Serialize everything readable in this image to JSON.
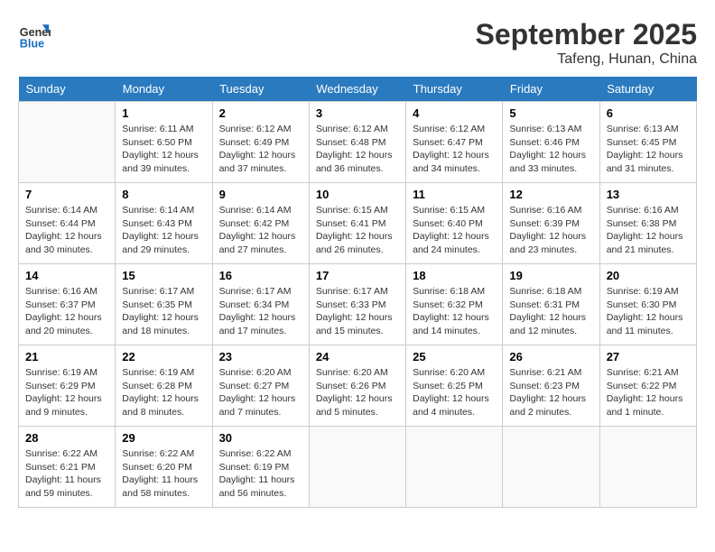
{
  "header": {
    "logo_line1": "General",
    "logo_line2": "Blue",
    "month_year": "September 2025",
    "location": "Tafeng, Hunan, China"
  },
  "days_of_week": [
    "Sunday",
    "Monday",
    "Tuesday",
    "Wednesday",
    "Thursday",
    "Friday",
    "Saturday"
  ],
  "weeks": [
    [
      {
        "day": "",
        "info": ""
      },
      {
        "day": "1",
        "info": "Sunrise: 6:11 AM\nSunset: 6:50 PM\nDaylight: 12 hours\nand 39 minutes."
      },
      {
        "day": "2",
        "info": "Sunrise: 6:12 AM\nSunset: 6:49 PM\nDaylight: 12 hours\nand 37 minutes."
      },
      {
        "day": "3",
        "info": "Sunrise: 6:12 AM\nSunset: 6:48 PM\nDaylight: 12 hours\nand 36 minutes."
      },
      {
        "day": "4",
        "info": "Sunrise: 6:12 AM\nSunset: 6:47 PM\nDaylight: 12 hours\nand 34 minutes."
      },
      {
        "day": "5",
        "info": "Sunrise: 6:13 AM\nSunset: 6:46 PM\nDaylight: 12 hours\nand 33 minutes."
      },
      {
        "day": "6",
        "info": "Sunrise: 6:13 AM\nSunset: 6:45 PM\nDaylight: 12 hours\nand 31 minutes."
      }
    ],
    [
      {
        "day": "7",
        "info": "Sunrise: 6:14 AM\nSunset: 6:44 PM\nDaylight: 12 hours\nand 30 minutes."
      },
      {
        "day": "8",
        "info": "Sunrise: 6:14 AM\nSunset: 6:43 PM\nDaylight: 12 hours\nand 29 minutes."
      },
      {
        "day": "9",
        "info": "Sunrise: 6:14 AM\nSunset: 6:42 PM\nDaylight: 12 hours\nand 27 minutes."
      },
      {
        "day": "10",
        "info": "Sunrise: 6:15 AM\nSunset: 6:41 PM\nDaylight: 12 hours\nand 26 minutes."
      },
      {
        "day": "11",
        "info": "Sunrise: 6:15 AM\nSunset: 6:40 PM\nDaylight: 12 hours\nand 24 minutes."
      },
      {
        "day": "12",
        "info": "Sunrise: 6:16 AM\nSunset: 6:39 PM\nDaylight: 12 hours\nand 23 minutes."
      },
      {
        "day": "13",
        "info": "Sunrise: 6:16 AM\nSunset: 6:38 PM\nDaylight: 12 hours\nand 21 minutes."
      }
    ],
    [
      {
        "day": "14",
        "info": "Sunrise: 6:16 AM\nSunset: 6:37 PM\nDaylight: 12 hours\nand 20 minutes."
      },
      {
        "day": "15",
        "info": "Sunrise: 6:17 AM\nSunset: 6:35 PM\nDaylight: 12 hours\nand 18 minutes."
      },
      {
        "day": "16",
        "info": "Sunrise: 6:17 AM\nSunset: 6:34 PM\nDaylight: 12 hours\nand 17 minutes."
      },
      {
        "day": "17",
        "info": "Sunrise: 6:17 AM\nSunset: 6:33 PM\nDaylight: 12 hours\nand 15 minutes."
      },
      {
        "day": "18",
        "info": "Sunrise: 6:18 AM\nSunset: 6:32 PM\nDaylight: 12 hours\nand 14 minutes."
      },
      {
        "day": "19",
        "info": "Sunrise: 6:18 AM\nSunset: 6:31 PM\nDaylight: 12 hours\nand 12 minutes."
      },
      {
        "day": "20",
        "info": "Sunrise: 6:19 AM\nSunset: 6:30 PM\nDaylight: 12 hours\nand 11 minutes."
      }
    ],
    [
      {
        "day": "21",
        "info": "Sunrise: 6:19 AM\nSunset: 6:29 PM\nDaylight: 12 hours\nand 9 minutes."
      },
      {
        "day": "22",
        "info": "Sunrise: 6:19 AM\nSunset: 6:28 PM\nDaylight: 12 hours\nand 8 minutes."
      },
      {
        "day": "23",
        "info": "Sunrise: 6:20 AM\nSunset: 6:27 PM\nDaylight: 12 hours\nand 7 minutes."
      },
      {
        "day": "24",
        "info": "Sunrise: 6:20 AM\nSunset: 6:26 PM\nDaylight: 12 hours\nand 5 minutes."
      },
      {
        "day": "25",
        "info": "Sunrise: 6:20 AM\nSunset: 6:25 PM\nDaylight: 12 hours\nand 4 minutes."
      },
      {
        "day": "26",
        "info": "Sunrise: 6:21 AM\nSunset: 6:23 PM\nDaylight: 12 hours\nand 2 minutes."
      },
      {
        "day": "27",
        "info": "Sunrise: 6:21 AM\nSunset: 6:22 PM\nDaylight: 12 hours\nand 1 minute."
      }
    ],
    [
      {
        "day": "28",
        "info": "Sunrise: 6:22 AM\nSunset: 6:21 PM\nDaylight: 11 hours\nand 59 minutes."
      },
      {
        "day": "29",
        "info": "Sunrise: 6:22 AM\nSunset: 6:20 PM\nDaylight: 11 hours\nand 58 minutes."
      },
      {
        "day": "30",
        "info": "Sunrise: 6:22 AM\nSunset: 6:19 PM\nDaylight: 11 hours\nand 56 minutes."
      },
      {
        "day": "",
        "info": ""
      },
      {
        "day": "",
        "info": ""
      },
      {
        "day": "",
        "info": ""
      },
      {
        "day": "",
        "info": ""
      }
    ]
  ]
}
